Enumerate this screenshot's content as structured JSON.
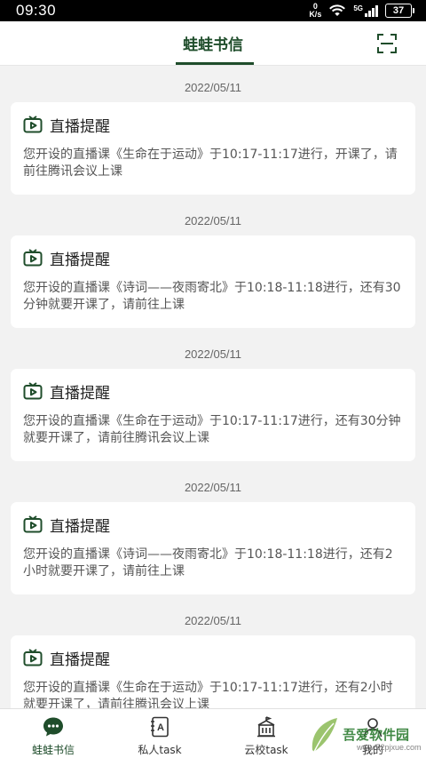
{
  "status_bar": {
    "time": "09:30",
    "net_speed_value": "0",
    "net_speed_unit": "K/s",
    "network_type": "5G",
    "battery": "37"
  },
  "header": {
    "title": "蛙蛙书信",
    "scan_icon": "scan-icon"
  },
  "messages": [
    {
      "date": "2022/05/11",
      "title": "直播提醒",
      "body": "您开设的直播课《生命在于运动》于10:17-11:17进行，开课了，请前往腾讯会议上课"
    },
    {
      "date": "2022/05/11",
      "title": "直播提醒",
      "body": "您开设的直播课《诗词——夜雨寄北》于10:18-11:18进行，还有30分钟就要开课了，请前往上课"
    },
    {
      "date": "2022/05/11",
      "title": "直播提醒",
      "body": "您开设的直播课《生命在于运动》于10:17-11:17进行，还有30分钟就要开课了，请前往腾讯会议上课"
    },
    {
      "date": "2022/05/11",
      "title": "直播提醒",
      "body": "您开设的直播课《诗词——夜雨寄北》于10:18-11:18进行，还有2小时就要开课了，请前往上课"
    },
    {
      "date": "2022/05/11",
      "title": "直播提醒",
      "body": "您开设的直播课《生命在于运动》于10:17-11:17进行，还有2小时就要开课了，请前往腾讯会议上课"
    }
  ],
  "tabbar": {
    "tabs": [
      {
        "label": "蛙蛙书信",
        "icon": "chat-icon",
        "active": true
      },
      {
        "label": "私人task",
        "icon": "contact-book-icon",
        "active": false
      },
      {
        "label": "云校task",
        "icon": "school-icon",
        "active": false
      },
      {
        "label": "我的",
        "icon": "profile-icon",
        "active": false
      }
    ]
  },
  "watermark": {
    "logo_text": "吾爱软件园",
    "url": "www.52pjxue.com"
  },
  "colors": {
    "brand": "#1f4d2b",
    "background": "#f2f2f2",
    "card": "#ffffff"
  }
}
